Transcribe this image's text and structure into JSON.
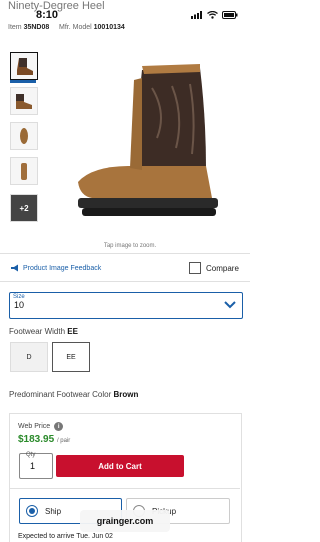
{
  "status_bar": {
    "time": "8:10"
  },
  "product": {
    "title_partial": "Ninety-Degree Heel",
    "item_label": "Item",
    "item_number": "35ND08",
    "mfr_label": "Mfr. Model",
    "mfr_model": "10010134"
  },
  "gallery": {
    "more_count": "+2",
    "zoom_hint": "Tap image to zoom."
  },
  "actions": {
    "feedback_label": "Product Image Feedback",
    "compare_label": "Compare"
  },
  "size_select": {
    "label": "Size",
    "value": "10"
  },
  "footwear_width": {
    "label": "Footwear Width",
    "selected": "EE",
    "options": [
      "D",
      "EE"
    ]
  },
  "color": {
    "label": "Predominant Footwear Color",
    "value": "Brown"
  },
  "pricing": {
    "web_price_label": "Web Price",
    "info_icon": "i",
    "price": "$183.95",
    "unit": "/ pair",
    "qty_label": "Qty",
    "qty_value": "1",
    "add_to_cart_label": "Add to Cart"
  },
  "fulfillment": {
    "ship_label": "Ship",
    "pickup_label": "Pickup",
    "expected_text": "Expected to arrive Tue. Jun 02"
  },
  "browser": {
    "domain": "grainger.com"
  },
  "colors": {
    "accent": "#1a5fa8",
    "cart": "#c8102e",
    "price": "#2a8a2a"
  }
}
